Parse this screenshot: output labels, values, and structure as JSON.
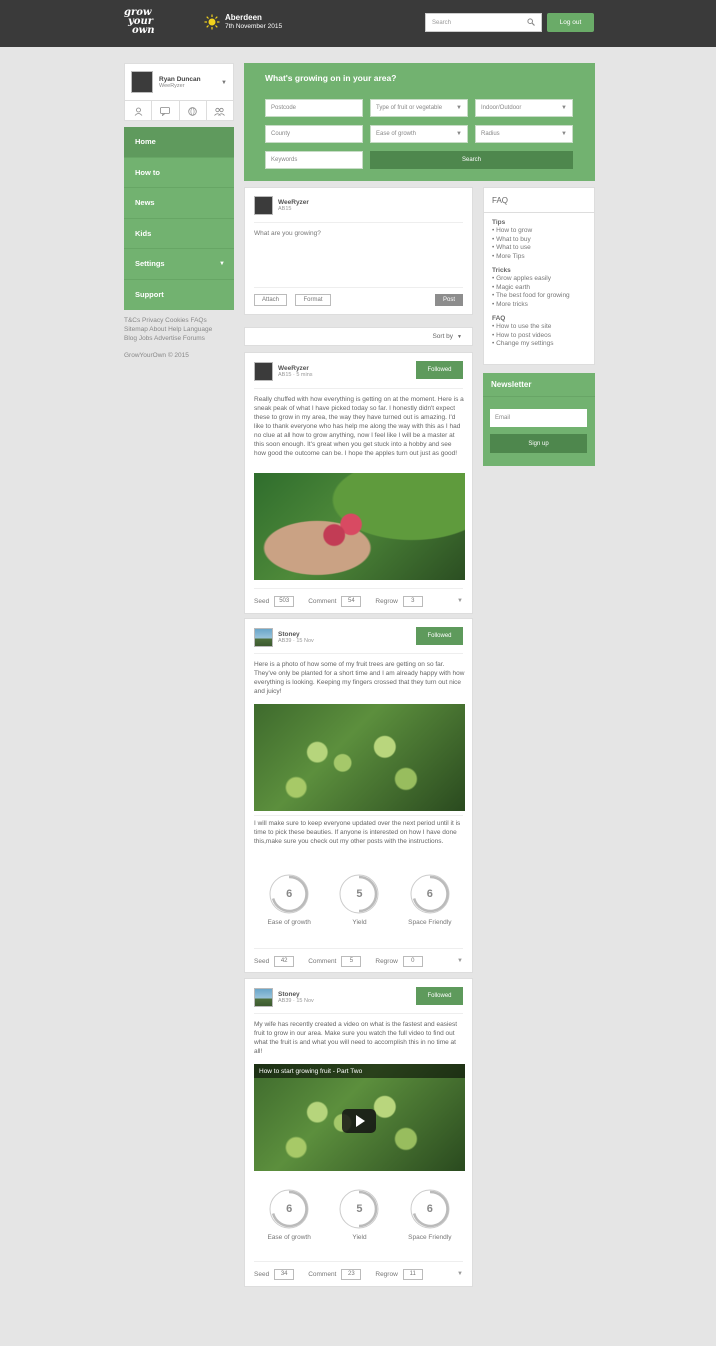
{
  "header": {
    "logo": [
      "grow",
      "your",
      "own"
    ],
    "weather": {
      "city": "Aberdeen",
      "date": "7th November 2015",
      "icon": "sun-icon"
    },
    "search_placeholder": "Search",
    "logout": "Log out"
  },
  "profile": {
    "name": "Ryan Duncan",
    "handle": "WeeRyzer"
  },
  "nav": [
    {
      "label": "Home",
      "active": true
    },
    {
      "label": "How to"
    },
    {
      "label": "News"
    },
    {
      "label": "Kids"
    },
    {
      "label": "Settings",
      "dropdown": true
    },
    {
      "label": "Support"
    }
  ],
  "footer_links": {
    "row1": "T&Cs  Privacy  Cookies  FAQs",
    "row2": "Sitemap  About  Help  Language",
    "row3": "Blog  Jobs  Advertise  Forums"
  },
  "copyright": "GrowYourOwn © 2015",
  "finder": {
    "title": "What's growing on in your area?",
    "postcode": "Postcode",
    "fruit_type": "Type of fruit or vegetable",
    "indoor": "Indoor/Outdoor",
    "county": "County",
    "ease": "Ease of growth",
    "radius": "Radius",
    "keywords": "Keywords",
    "search": "Search"
  },
  "composer": {
    "user": "WeeRyzer",
    "meta": "AB15",
    "prompt": "What are you growing?",
    "attach": "Attach",
    "format": "Format",
    "post": "Post"
  },
  "sort": "Sort by",
  "posts": [
    {
      "user": "WeeRyzer",
      "meta": "AB15 · 5 mins",
      "followed": "Followed",
      "text": "Really chuffed with how everything is getting on at the moment. Here is a sneak peak of what I have picked today so far. I honestly didn't expect these to grow in my area, the way they have turned out is amazing. I'd like to thank everyone who has help me along the way with this as I had no clue at all how to grow anything, now I feel like I will be a master at this soon enough. It's great when you get stuck into a hobby and see how good the outcome can be. I hope the apples turn out just as good!",
      "seed": "503",
      "comment": "54",
      "regrow": "3"
    },
    {
      "user": "Stoney",
      "meta": "AB39 · 15 Nov",
      "followed": "Followed",
      "text": "Here is a photo of how some of my fruit trees are getting on so far. They've only be planted for a short time and I am already happy with how everything is looking. Keeping my fingers crossed that they turn out nice and juicy!",
      "text2": "I will make sure to keep everyone updated over the next period until it is time to pick these beauties. If anyone is interested on how I have done this,make sure you check out my other posts with the instructions.",
      "ratings": [
        {
          "label": "Ease of growth",
          "value": 6
        },
        {
          "label": "Yield",
          "value": 5
        },
        {
          "label": "Space Friendly",
          "value": 6
        }
      ],
      "seed": "42",
      "comment": "5",
      "regrow": "0"
    },
    {
      "user": "Stoney",
      "meta": "AB39 · 15 Nov",
      "followed": "Followed",
      "text": "My wife has recently created a video on what is the fastest and easiest fruit to grow in our area. Make sure you watch the full video to find out what the fruit is and what you will need to accomplish this in no time at all!",
      "video_title": "How to start growing fruit - Part Two",
      "ratings": [
        {
          "label": "Ease of growth",
          "value": 6
        },
        {
          "label": "Yield",
          "value": 5
        },
        {
          "label": "Space Friendly",
          "value": 6
        }
      ],
      "seed": "34",
      "comment": "23",
      "regrow": "11"
    }
  ],
  "action_labels": {
    "seed": "Seed",
    "comment": "Comment",
    "regrow": "Regrow"
  },
  "faq": {
    "title": "FAQ",
    "sections": [
      {
        "title": "Tips",
        "links": [
          "• How to grow",
          "• What to buy",
          "• What to use",
          "• More Tips"
        ]
      },
      {
        "title": "Tricks",
        "links": [
          "• Grow apples easily",
          "• Magic earth",
          "• The best food for growing",
          "• More tricks"
        ]
      },
      {
        "title": "FAQ",
        "links": [
          "• How to use the site",
          "• How to post videos",
          "• Change my settings"
        ]
      }
    ]
  },
  "newsletter": {
    "title": "Newsletter",
    "email_placeholder": "Email",
    "signup": "Sign up"
  },
  "colors": {
    "brand_green": "#72b270",
    "dark_green": "#4e874d",
    "header_bg": "#3a3a3a"
  }
}
